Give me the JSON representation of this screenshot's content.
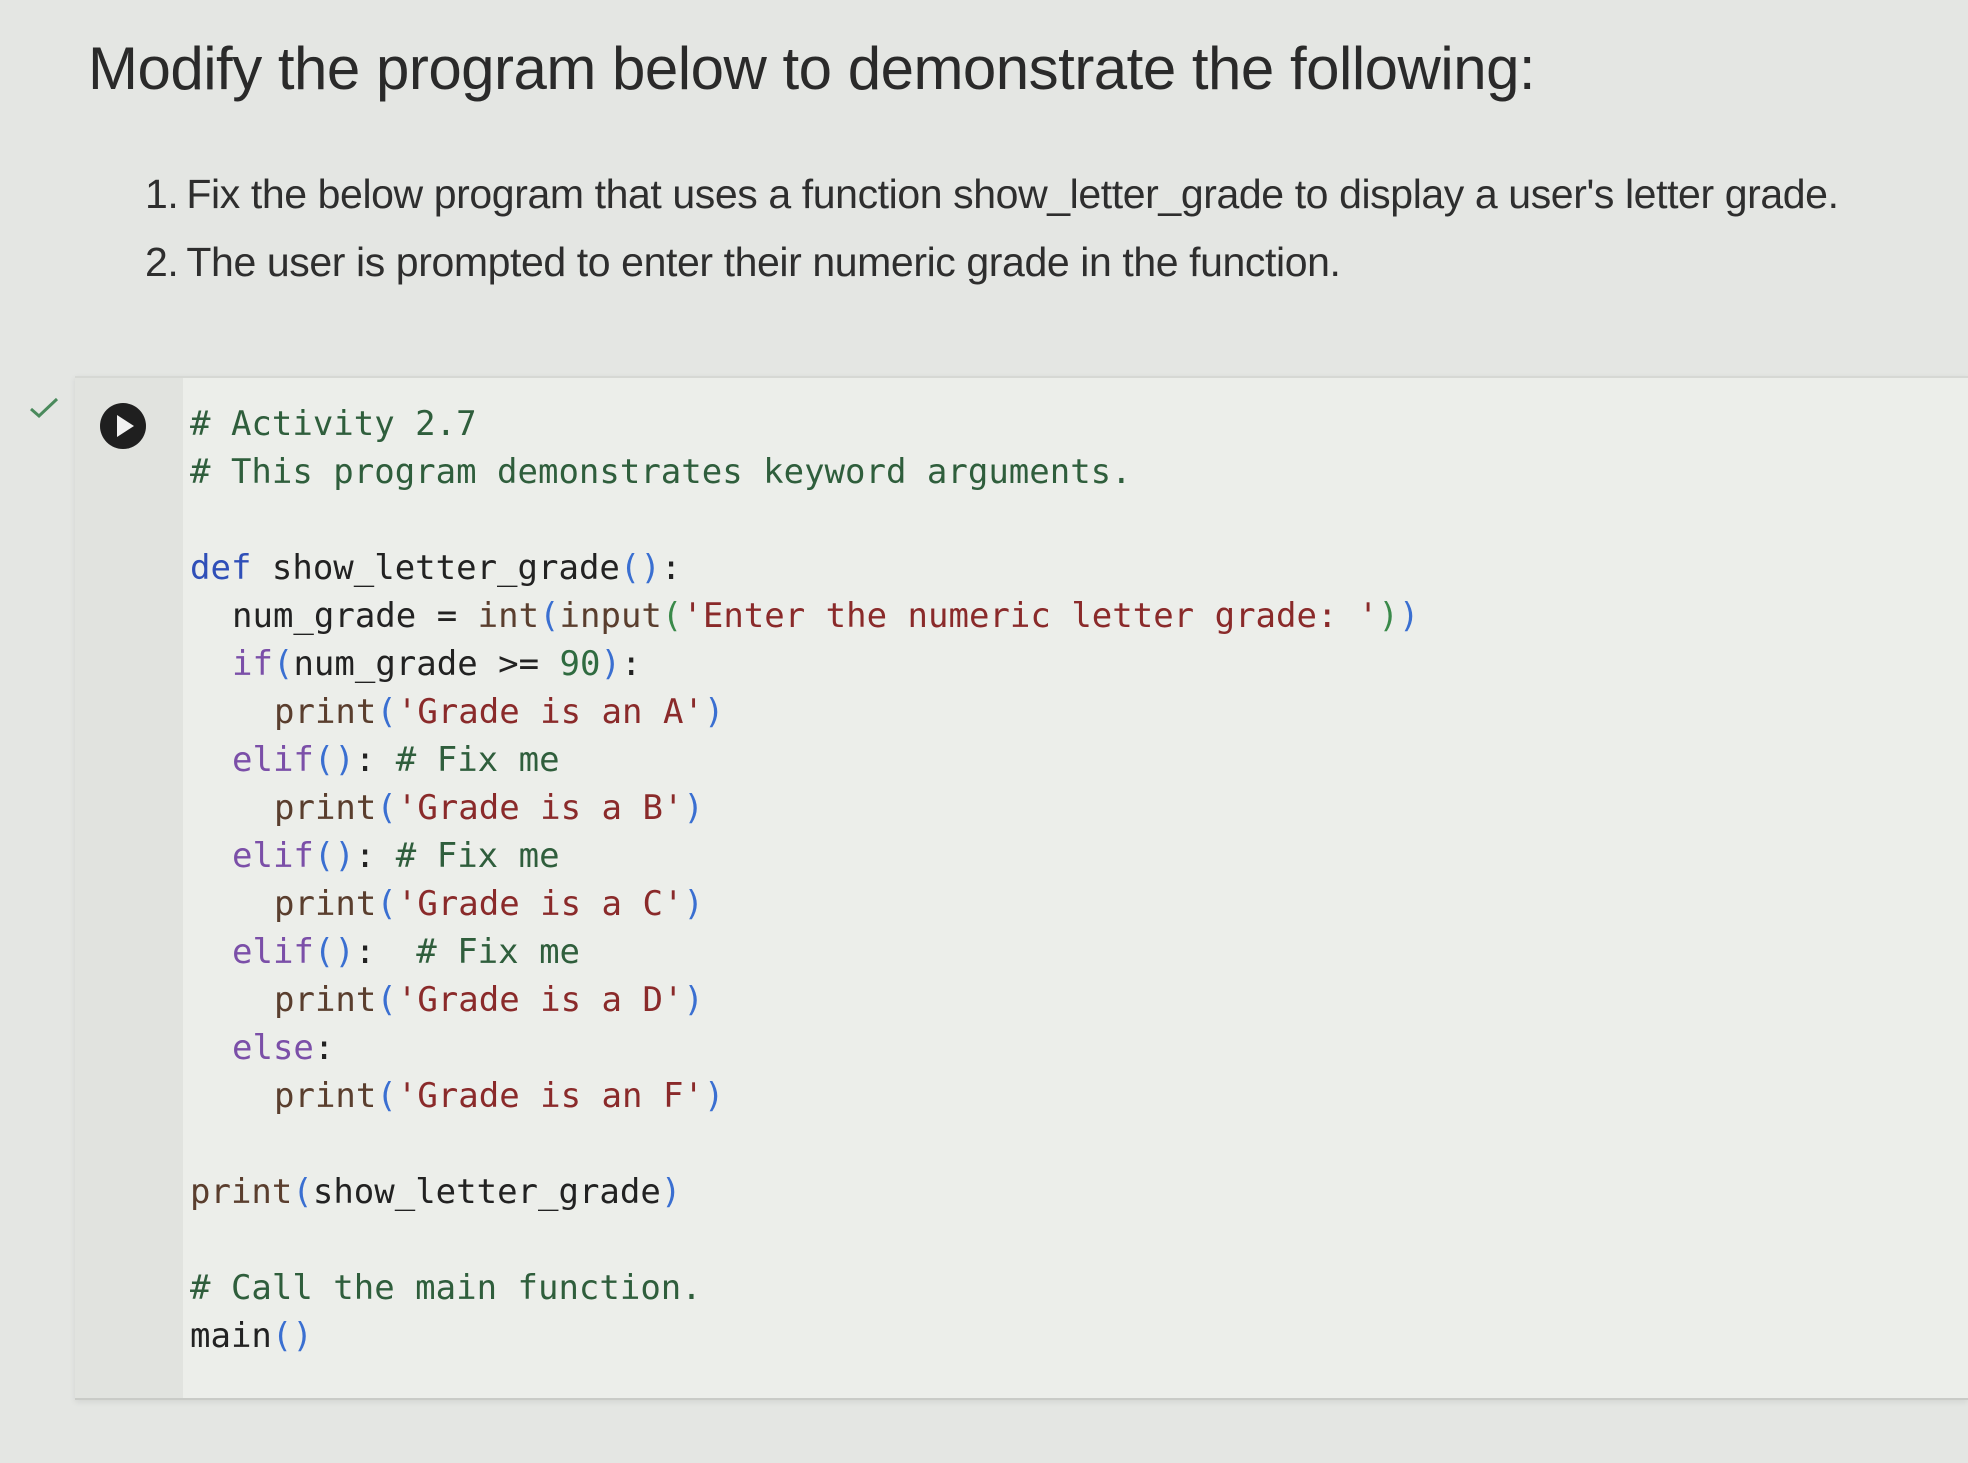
{
  "heading": "Modify the program below to demonstrate the following:",
  "instructions": [
    {
      "num": "1.",
      "text": "Fix the below program that uses a function show_letter_grade to display a user's letter grade."
    },
    {
      "num": "2.",
      "text": "The user is prompted to enter their numeric grade in the function."
    }
  ],
  "cell": {
    "status_icon": "check-icon",
    "run_icon": "play-icon",
    "code": {
      "comment_activity": "# Activity 2.7",
      "comment_desc": "# This program demonstrates keyword arguments.",
      "def_kw": "def",
      "func_name": " show_letter_grade",
      "func_parens": "()",
      "colon": ":",
      "num_grade_assign": "num_grade = ",
      "int_fn": "int",
      "input_fn": "input",
      "prompt_str": "'Enter the numeric letter grade: '",
      "if_kw": "if",
      "if_cond": "num_grade >= ",
      "if_num": "90",
      "print_fn": "print",
      "str_a": "'Grade is an A'",
      "elif_kw": "elif",
      "fix_comment": "# Fix me",
      "str_b": "'Grade is a B'",
      "str_c": "'Grade is a C'",
      "str_d": "'Grade is a D'",
      "else_kw": "else",
      "str_f": "'Grade is an F'",
      "print_arg": "show_letter_grade",
      "comment_main": "# Call the main function.",
      "main_fn": "main"
    }
  }
}
